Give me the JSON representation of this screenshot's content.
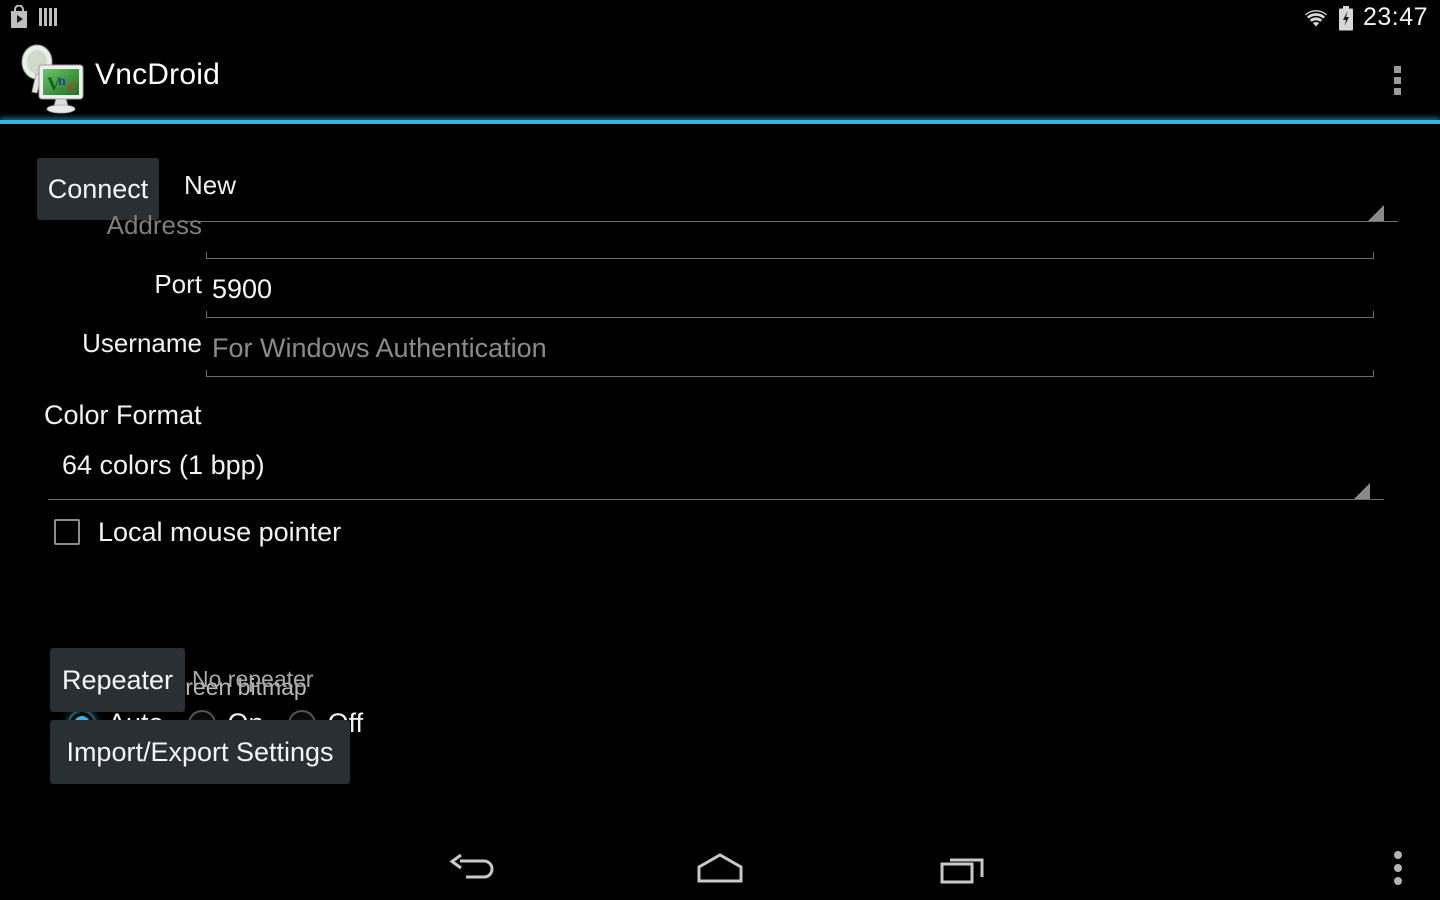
{
  "status_bar": {
    "icons": [
      "play-store-icon",
      "bars-icon"
    ],
    "wifi_icon": "wifi-icon",
    "battery_icon": "battery-charging-icon",
    "clock": "23:47"
  },
  "action_bar": {
    "app_icon": "vncdroid-app-icon",
    "title": "VncDroid",
    "overflow_icon": "overflow-menu-icon",
    "divider_color": "#33b5e5"
  },
  "form": {
    "connect_button": "Connect",
    "profile_spinner": {
      "value": "New",
      "arrow_icon": "spinner-triangle-icon"
    },
    "fields": [
      {
        "label": "Address",
        "value": "",
        "placeholder": "",
        "dim": true
      },
      {
        "label": "Port",
        "value": "5900",
        "placeholder": ""
      },
      {
        "label": "Username",
        "value": "",
        "placeholder": "For Windows Authentication"
      }
    ],
    "color_format": {
      "heading": "Color Format",
      "value": "64 colors (1 bpp)",
      "arrow_icon": "spinner-triangle-icon"
    },
    "local_mouse_pointer": {
      "label": "Local mouse pointer",
      "checked": false
    },
    "force_fullscreen_bitmap": {
      "caption": "Force full-screen bitmap",
      "options": [
        "Auto",
        "On",
        "Off"
      ],
      "selected": "Auto",
      "accent_color": "#33b5e5"
    },
    "repeater": {
      "button": "Repeater",
      "status": "No repeater"
    },
    "import_export_button": "Import/Export Settings"
  },
  "nav_bar": {
    "back_icon": "back-arrow-icon",
    "home_icon": "home-icon",
    "recents_icon": "recents-icon",
    "menu_icon": "legacy-menu-icon"
  }
}
